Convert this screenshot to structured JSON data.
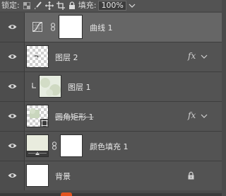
{
  "toolbar": {
    "lock_label": "锁定:",
    "fill_label": "填充:",
    "fill_value": "100%",
    "lock_icons": [
      "checker-lock-icon",
      "brush-icon",
      "move-icon",
      "crop-icon",
      "padlock-icon"
    ]
  },
  "layers": [
    {
      "name": "曲线 1",
      "type": "adjustment",
      "selected": true,
      "visible": true
    },
    {
      "name": "图层 2",
      "type": "pixel",
      "fx": "fx",
      "visible": true
    },
    {
      "name": "图层 1",
      "type": "clipped-pixel",
      "visible": true
    },
    {
      "name": "圆角矩形 1",
      "type": "shape",
      "fx": "fx",
      "visible": true
    },
    {
      "name": "颜色填充 1",
      "type": "fill",
      "visible": true
    },
    {
      "name": "背景",
      "type": "background",
      "locked": true,
      "visible": true
    }
  ]
}
